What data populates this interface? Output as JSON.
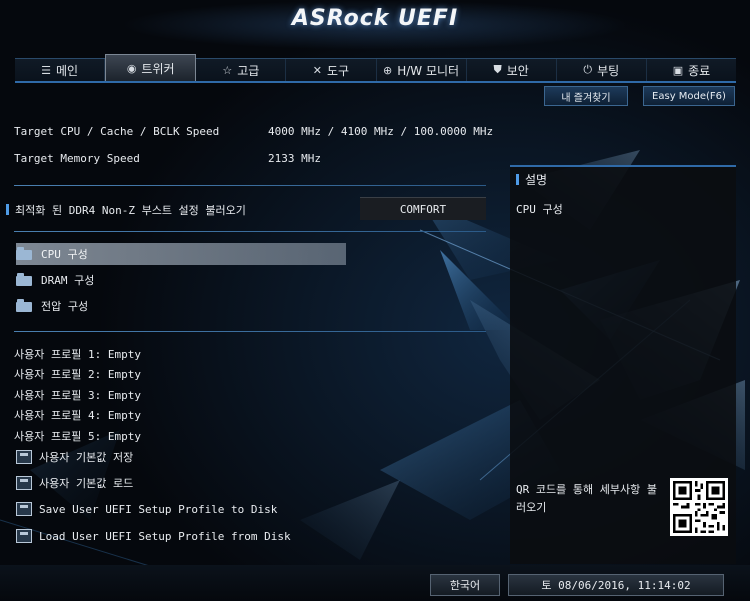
{
  "brand": {
    "logo": "ASRock UEFI"
  },
  "tabs": [
    {
      "label": "메인",
      "icon": "list-icon",
      "glyph": "☰",
      "active": false
    },
    {
      "label": "트위커",
      "icon": "tweaker-icon",
      "glyph": "◉",
      "active": true
    },
    {
      "label": "고급",
      "icon": "star-icon",
      "glyph": "☆",
      "active": false
    },
    {
      "label": "도구",
      "icon": "tools-icon",
      "glyph": "✕",
      "active": false
    },
    {
      "label": "H/W 모니터",
      "icon": "monitor-icon",
      "glyph": "⊕",
      "active": false
    },
    {
      "label": "보안",
      "icon": "shield-icon",
      "glyph": "⛊",
      "active": false
    },
    {
      "label": "부팅",
      "icon": "power-icon",
      "glyph": "⏻",
      "active": false
    },
    {
      "label": "종료",
      "icon": "exit-icon",
      "glyph": "▣",
      "active": false
    }
  ],
  "top_buttons": {
    "favorites": "내 즐겨찾기",
    "easy_mode": "Easy Mode(F6)"
  },
  "info": {
    "cpu_label": "Target CPU / Cache / BCLK Speed",
    "cpu_value": "4000 MHz / 4100 MHz / 100.0000 MHz",
    "mem_label": "Target Memory Speed",
    "mem_value": "2133 MHz"
  },
  "boost": {
    "label": "최적화 된 DDR4 Non-Z 부스트 설정 불러오기",
    "value": "COMFORT"
  },
  "menu": {
    "cpu": "CPU 구성",
    "dram": "DRAM 구성",
    "voltage": "전압 구성"
  },
  "profiles": [
    "사용자 프로필 1: Empty",
    "사용자 프로필 2: Empty",
    "사용자 프로필 3: Empty",
    "사용자 프로필 4: Empty",
    "사용자 프로필 5: Empty"
  ],
  "actions": {
    "save_default": "사용자 기본값 저장",
    "load_default": "사용자 기본값 로드",
    "save_disk": "Save User UEFI Setup Profile to Disk",
    "load_disk": "Load User UEFI Setup Profile from Disk"
  },
  "description": {
    "title": "설명",
    "text": "CPU 구성",
    "qr_text": "QR 코드를 통해 세부사항 불러오기"
  },
  "bottom": {
    "language": "한국어",
    "datetime": "토 08/06/2016, 11:14:02"
  },
  "colors": {
    "accent": "#2f6aa8",
    "background": "#05080d",
    "text": "#e8ebef"
  }
}
